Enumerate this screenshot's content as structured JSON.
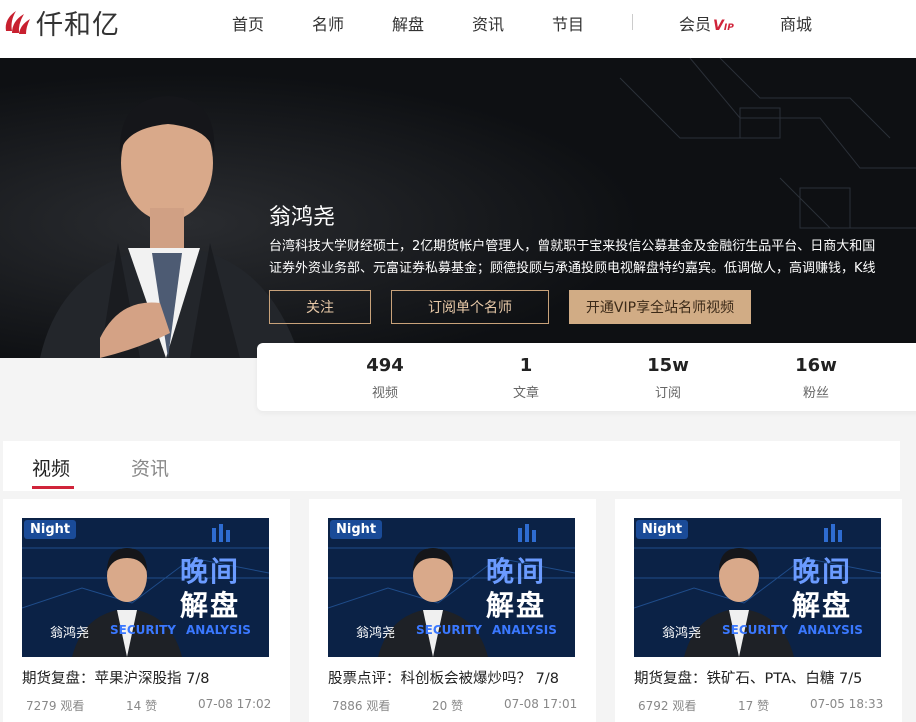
{
  "nav": {
    "logo_text": "仟和亿",
    "items": [
      "首页",
      "名师",
      "解盘",
      "资讯",
      "节目"
    ],
    "member": "会员",
    "vip_badge": "V",
    "vip_small": "IP",
    "mall": "商城"
  },
  "hero": {
    "name": "翁鸿尧",
    "bio_line1": "台湾科技大学财经硕士，2亿期货帐户管理人，曾就职于宝来投信公募基金及金融衍生品平台、日商大和国",
    "bio_line2": "证券外资业务部、元富证券私募基金；顾德投顾与承通投顾电视解盘特约嘉宾。低调做人，高调赚钱，K线",
    "btn_follow": "关注",
    "btn_subscribe": "订阅单个名师",
    "btn_vip": "开通VIP享全站名师视频"
  },
  "stats": [
    {
      "value": "494",
      "label": "视频"
    },
    {
      "value": "1",
      "label": "文章"
    },
    {
      "value": "15w",
      "label": "订阅"
    },
    {
      "value": "16w",
      "label": "粉丝"
    }
  ],
  "tabs": [
    "视频",
    "资讯"
  ],
  "thumb": {
    "night": "Night",
    "big1": "晚间",
    "big2": "解盘",
    "name": "翁鸿尧",
    "sec": "SECURITY",
    "ana": "ANALYSIS"
  },
  "cards": [
    {
      "title": "期货复盘：苹果沪深股指 7/8",
      "views": "7279 观看",
      "likes": "14 赞",
      "date": "07-08 17:02"
    },
    {
      "title": "股票点评：科创板会被爆炒吗？ 7/8",
      "views": "7886 观看",
      "likes": "20 赞",
      "date": "07-08 17:01"
    },
    {
      "title": "期货复盘：铁矿石、PTA、白糖 7/5",
      "views": "6792 观看",
      "likes": "17 赞",
      "date": "07-05 18:33"
    }
  ],
  "colors": {
    "accent": "#d0243a",
    "gold": "#d1ac85",
    "thumb_blue": "#3a78ff"
  }
}
